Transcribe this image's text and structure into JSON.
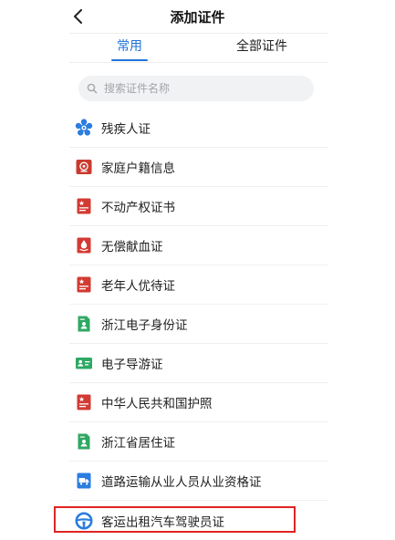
{
  "header": {
    "title": "添加证件",
    "back_icon": "chevron-left-icon"
  },
  "tabs": [
    {
      "label": "常用",
      "active": true
    },
    {
      "label": "全部证件",
      "active": false
    }
  ],
  "search": {
    "placeholder": "搜索证件名称",
    "value": "",
    "icon": "search-icon"
  },
  "certificates": [
    {
      "label": "残疾人证",
      "icon": "disability-flower-icon",
      "color": "#2b7de0"
    },
    {
      "label": "家庭户籍信息",
      "icon": "emblem-icon",
      "color": "#c93a2f"
    },
    {
      "label": "不动产权证书",
      "icon": "document-star-icon",
      "color": "#d23b33"
    },
    {
      "label": "无偿献血证",
      "icon": "blood-drop-icon",
      "color": "#d23b33"
    },
    {
      "label": "老年人优待证",
      "icon": "document-star-icon",
      "color": "#d23b33"
    },
    {
      "label": "浙江电子身份证",
      "icon": "person-doc-icon",
      "color": "#2fa864"
    },
    {
      "label": "电子导游证",
      "icon": "id-card-icon",
      "color": "#2fa864"
    },
    {
      "label": "中华人民共和国护照",
      "icon": "document-star-icon",
      "color": "#d23b33"
    },
    {
      "label": "浙江省居住证",
      "icon": "person-doc-icon",
      "color": "#2fa864"
    },
    {
      "label": "道路运输从业人员从业资格证",
      "icon": "truck-icon",
      "color": "#2b7de0"
    },
    {
      "label": "客运出租汽车驾驶员证",
      "icon": "steering-wheel-icon",
      "color": "#2b7de0"
    }
  ],
  "colors": {
    "accent": "#1f73d8",
    "highlight_border": "#e02424"
  }
}
